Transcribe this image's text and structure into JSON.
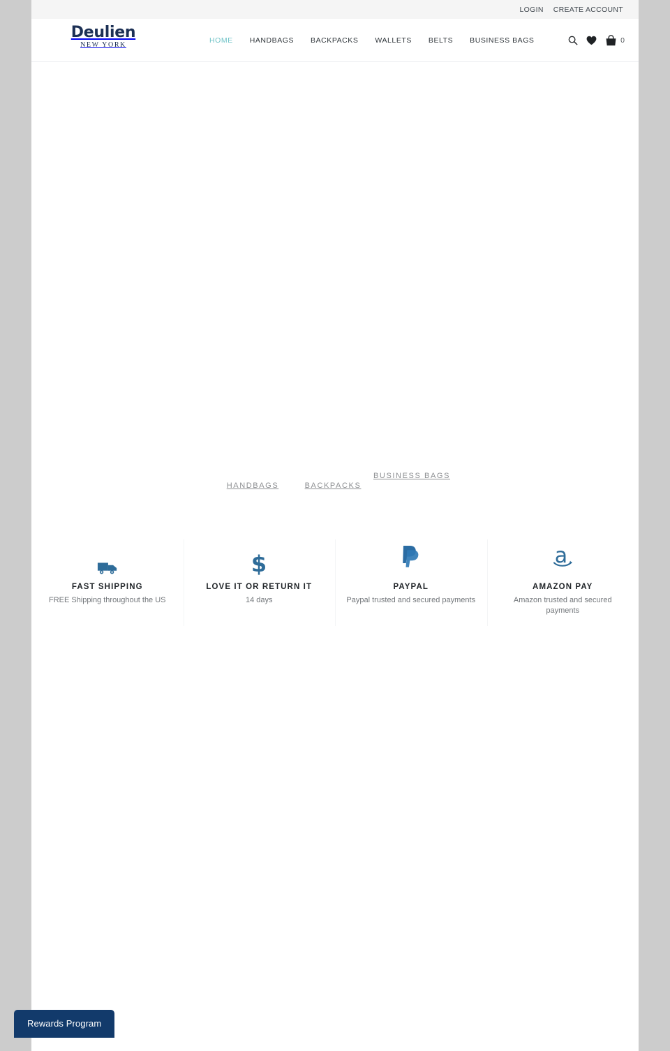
{
  "theme": {
    "outer_bg": "#cccccc",
    "page_bg": "#ffffff",
    "topbar_bg": "#f5f5f5",
    "brand_navy": "#1c3055",
    "accent_teal": "#6fc3c7",
    "icon_blue": "#2e6c99",
    "rewards_bg": "#123a6b",
    "muted_text": "#8d8f92"
  },
  "topbar": {
    "links": [
      {
        "label": "LOGIN",
        "name": "login-link"
      },
      {
        "label": "CREATE ACCOUNT",
        "name": "create-account-link"
      }
    ]
  },
  "header": {
    "logo": {
      "name": "Deulien",
      "tagline": "NEW YORK"
    },
    "nav": [
      {
        "label": "HOME",
        "active": true
      },
      {
        "label": "HANDBAGS",
        "active": false
      },
      {
        "label": "BACKPACKS",
        "active": false
      },
      {
        "label": "WALLETS",
        "active": false
      },
      {
        "label": "BELTS",
        "active": false
      },
      {
        "label": "BUSINESS BAGS",
        "active": false
      }
    ],
    "icons": {
      "search": "search-icon",
      "wishlist": "heart-icon",
      "cart": "shopping-bag-icon"
    },
    "cart_count": "0"
  },
  "collections": [
    {
      "label": "HANDBAGS"
    },
    {
      "label": "BACKPACKS"
    },
    {
      "label": "BUSINESS BAGS"
    }
  ],
  "features": [
    {
      "icon": "delivery-truck-icon",
      "title": "FAST SHIPPING",
      "subtitle": "FREE Shipping throughout the US"
    },
    {
      "icon": "dollar-sign-icon",
      "title": "LOVE IT OR RETURN IT",
      "subtitle": "14 days"
    },
    {
      "icon": "paypal-icon",
      "title": "PAYPAL",
      "subtitle": "Paypal trusted and secured payments"
    },
    {
      "icon": "amazon-pay-icon",
      "title": "AMAZON PAY",
      "subtitle": "Amazon trusted and secured payments"
    }
  ],
  "rewards_widget": {
    "label": "Rewards Program"
  }
}
